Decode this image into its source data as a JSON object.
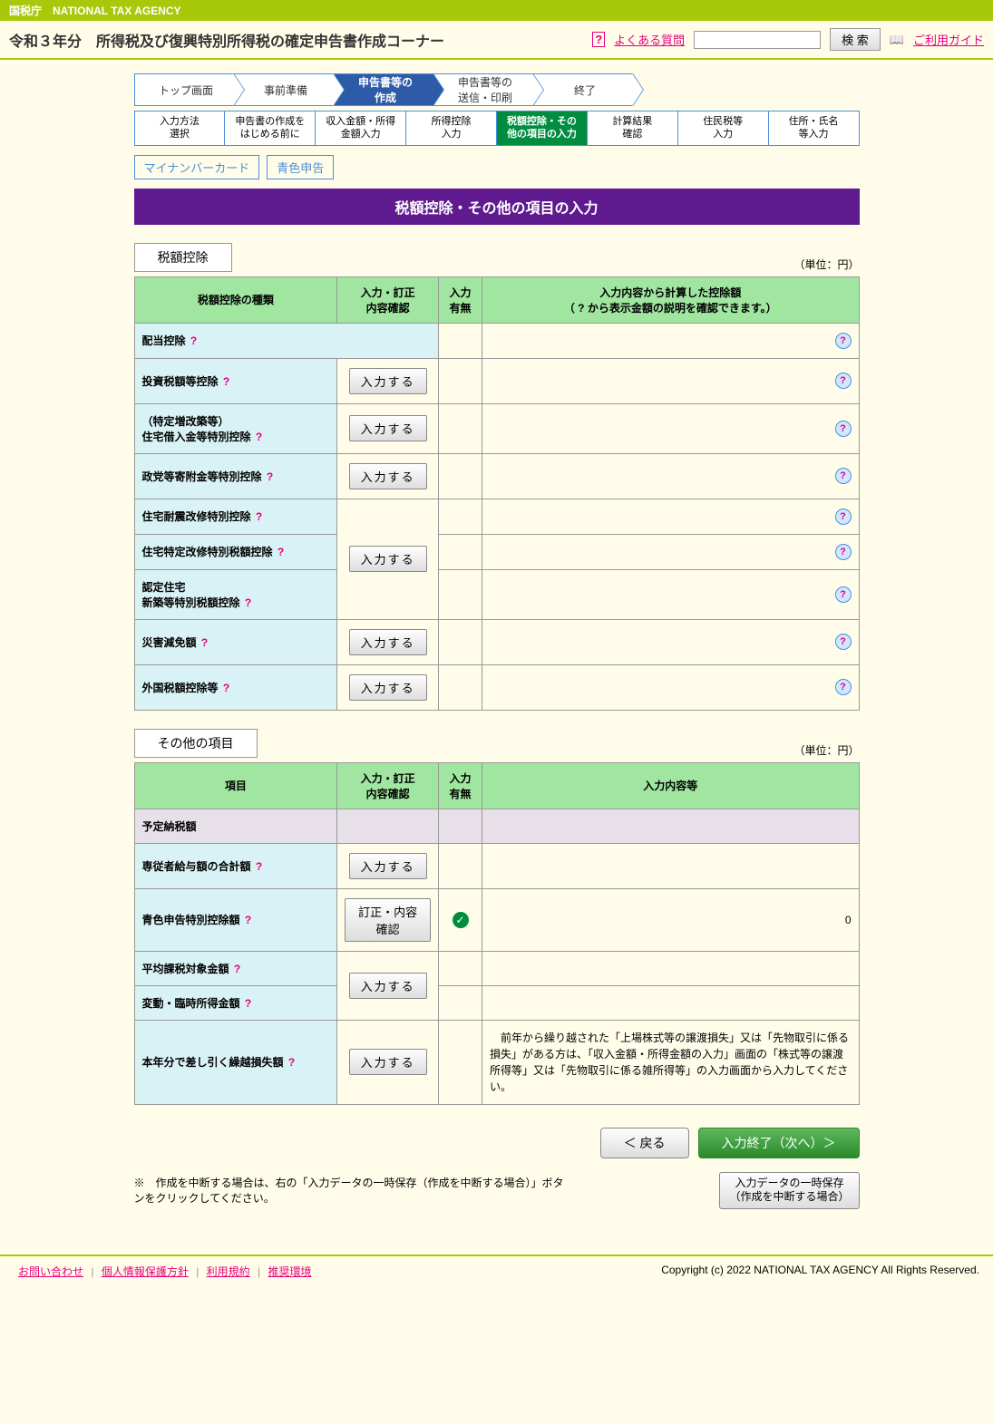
{
  "top_bar": "国税庁　NATIONAL TAX AGENCY",
  "page_title": "令和３年分　所得税及び復興特別所得税の確定申告書作成コーナー",
  "header": {
    "faq": "よくある質問",
    "search_btn": "検 索",
    "guide": "ご利用ガイド"
  },
  "nav": [
    "トップ画面",
    "事前準備",
    "申告書等の\n作成",
    "申告書等の\n送信・印刷",
    "終了"
  ],
  "subnav": [
    "入力方法\n選択",
    "申告書の作成をはじめる前に",
    "収入金額・所得金額入力",
    "所得控除\n入力",
    "税額控除・その他の項目の入力",
    "計算結果\n確認",
    "住民税等\n入力",
    "住所・氏名\n等入力"
  ],
  "tags": [
    "マイナンバーカード",
    "青色申告"
  ],
  "section_title": "税額控除・その他の項目の入力",
  "section1": {
    "heading": "税額控除",
    "unit": "（単位：円）",
    "headers": [
      "税額控除の種類",
      "入力・訂正\n内容確認",
      "入力\n有無",
      "入力内容から計算した控除額\n（ ? から表示金額の説明を確認できます。）"
    ],
    "rows": [
      {
        "name": "配当控除",
        "btn": ""
      },
      {
        "name": "投資税額等控除",
        "btn": "入力する"
      },
      {
        "name": "（特定増改築等）\n住宅借入金等特別控除",
        "btn": "入力する"
      },
      {
        "name": "政党等寄附金等特別控除",
        "btn": "入力する"
      },
      {
        "name": "住宅耐震改修特別控除",
        "btn": ""
      },
      {
        "name": "住宅特定改修特別税額控除",
        "btn": "入力する"
      },
      {
        "name": "認定住宅\n新築等特別税額控除",
        "btn": ""
      },
      {
        "name": "災害減免額",
        "btn": "入力する"
      },
      {
        "name": "外国税額控除等",
        "btn": "入力する"
      }
    ]
  },
  "section2": {
    "heading": "その他の項目",
    "unit": "（単位：円）",
    "headers": [
      "項目",
      "入力・訂正\n内容確認",
      "入力\n有無",
      "入力内容等"
    ],
    "rows": [
      {
        "name": "予定納税額"
      },
      {
        "name": "専従者給与額の合計額",
        "btn": "入力する"
      },
      {
        "name": "青色申告特別控除額",
        "btn": "訂正・内容確認",
        "check": true,
        "val": "0"
      },
      {
        "name": "平均課税対象金額"
      },
      {
        "name": "変動・臨時所得金額",
        "btn_merge": "入力する"
      },
      {
        "name": "本年分で差し引く繰越損失額",
        "btn": "入力する",
        "note": "　前年から繰り越された「上場株式等の譲渡損失」又は「先物取引に係る損失」がある方は、「収入金額・所得金額の入力」画面の「株式等の譲渡所得等」又は「先物取引に係る雑所得等」の入力画面から入力してください。"
      }
    ]
  },
  "buttons": {
    "back": "＜ 戻る",
    "next": "入力終了（次へ）＞",
    "save_note": "※　作成を中断する場合は、右の「入力データの一時保存（作成を中断する場合）」ボタンをクリックしてください。",
    "save": "入力データの一時保存\n（作成を中断する場合）"
  },
  "footer": {
    "links": [
      "お問い合わせ",
      "個人情報保護方針",
      "利用規約",
      "推奨環境"
    ],
    "copyright": "Copyright (c) 2022 NATIONAL TAX AGENCY All Rights Reserved."
  }
}
